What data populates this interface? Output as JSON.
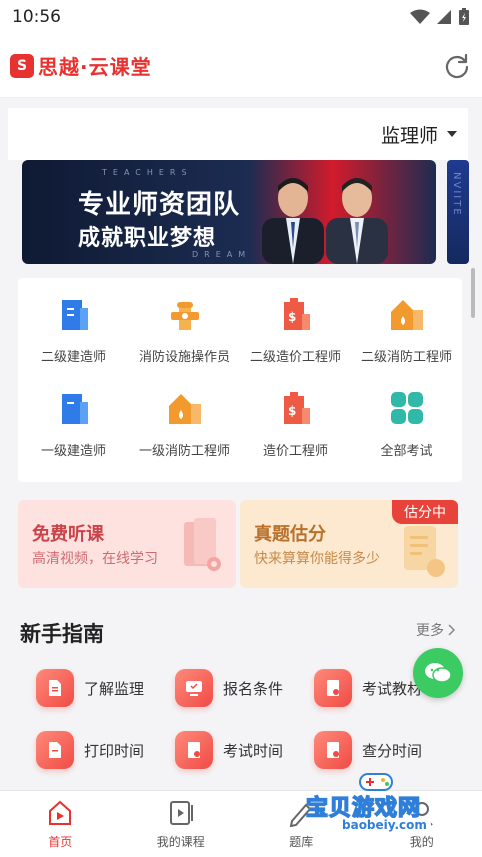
{
  "status_bar": {
    "time": "10:56"
  },
  "app": {
    "logo_text": "思越·云课堂",
    "logo_mark": "S"
  },
  "exam_selector": {
    "value": "监理师"
  },
  "banner": {
    "headline": "专业师资团队",
    "subline": "成就职业梦想",
    "deco_top": "TEACHERS",
    "deco_bottom": "DREAM",
    "peek_text": "NVIITE"
  },
  "categories": [
    {
      "label": "二级建造师",
      "icon": "building-icon"
    },
    {
      "label": "消防设施操作员",
      "icon": "hydrant-icon"
    },
    {
      "label": "二级造价工程师",
      "icon": "cost-icon"
    },
    {
      "label": "二级消防工程师",
      "icon": "fire-house-icon"
    },
    {
      "label": "一级建造师",
      "icon": "building-icon"
    },
    {
      "label": "一级消防工程师",
      "icon": "fire-house-icon"
    },
    {
      "label": "造价工程师",
      "icon": "cost-icon"
    },
    {
      "label": "全部考试",
      "icon": "grid-icon"
    }
  ],
  "promos": {
    "left": {
      "title": "免费听课",
      "subtitle": "高清视频，在线学习"
    },
    "right": {
      "title": "真题估分",
      "subtitle": "快来算算你能得多少",
      "tag": "估分中"
    }
  },
  "guide": {
    "title": "新手指南",
    "more": "更多",
    "items": [
      {
        "label": "了解监理"
      },
      {
        "label": "报名条件"
      },
      {
        "label": "考试教材"
      },
      {
        "label": "打印时间"
      },
      {
        "label": "考试时间"
      },
      {
        "label": "查分时间"
      }
    ]
  },
  "tabs": [
    {
      "label": "首页",
      "icon": "home-play-icon",
      "active": true
    },
    {
      "label": "我的课程",
      "icon": "course-play-icon",
      "active": false
    },
    {
      "label": "题库",
      "icon": "pen-icon",
      "active": false
    },
    {
      "label": "我的",
      "icon": "user-icon",
      "active": false
    }
  ],
  "watermark": {
    "main": "宝贝游戏网",
    "sub": "baobeiy.com"
  },
  "colors": {
    "brand": "#e8322f",
    "fab": "#3ccb63",
    "icon_blue": "#2f7be8",
    "icon_orange": "#f39a2e",
    "icon_red": "#ef5a45",
    "icon_teal": "#30b8a8"
  }
}
